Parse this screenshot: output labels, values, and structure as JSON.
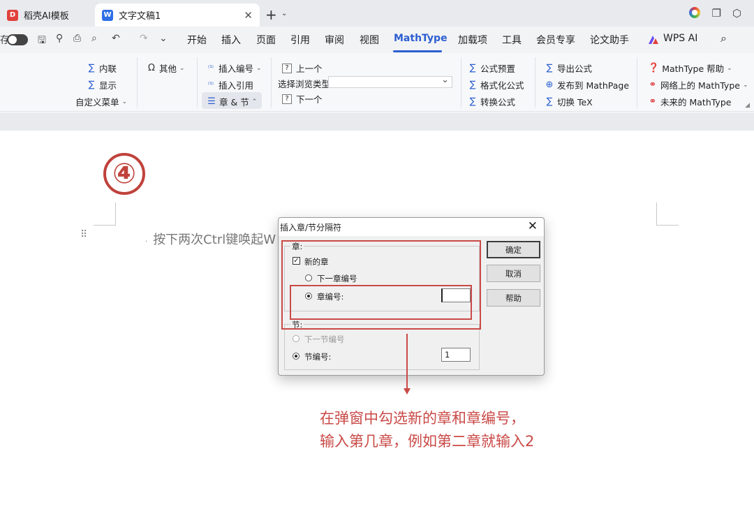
{
  "tabs": [
    {
      "label": "稻壳AI模板",
      "icon": "docer-icon"
    },
    {
      "label": "文字文稿1",
      "icon": "wps-writer-icon"
    }
  ],
  "quick_access": {
    "autosave_label": "存"
  },
  "menu": [
    "开始",
    "插入",
    "页面",
    "引用",
    "审阅",
    "视图",
    "MathType",
    "加载项",
    "工具",
    "会员专享",
    "论文助手",
    "WPS AI"
  ],
  "active_menu": "MathType",
  "ribbon": {
    "inline": "内联",
    "display": "显示",
    "custom_menu": "自定义菜单",
    "other": "其他",
    "insert_number": "插入编号",
    "insert_reference": "插入引用",
    "chapter_section": "章 & 节",
    "prev": "上一个",
    "browse_type": "选择浏览类型",
    "next": "下一个",
    "formula_preset": "公式预置",
    "format_formula": "格式化公式",
    "convert_formula": "转换公式",
    "export_formula": "导出公式",
    "publish_mathpage": "发布到 MathPage",
    "toggle_tex": "切换 TeX",
    "mathtype_help": "MathType 帮助",
    "mathtype_online": "网络上的 MathType",
    "mathtype_future": "未来的 MathType"
  },
  "document": {
    "step_marker": "④",
    "text": "按下两次Ctrl键唤起W"
  },
  "dialog": {
    "title": "插入章/节分隔符",
    "chapter_group": "章:",
    "new_chapter": "新的章",
    "new_chapter_checked": true,
    "next_chapter_number": "下一章编号",
    "chapter_number": "章编号:",
    "chapter_number_value": "",
    "section_group": "节:",
    "next_section_number": "下一节编号",
    "section_number": "节编号:",
    "section_number_value": "1",
    "ok": "确定",
    "cancel": "取消",
    "help": "帮助"
  },
  "annotation": {
    "line1": "在弹窗中勾选新的章和章编号，",
    "line2": "输入第几章，例如第二章就输入2",
    "color": "#c94a47"
  }
}
